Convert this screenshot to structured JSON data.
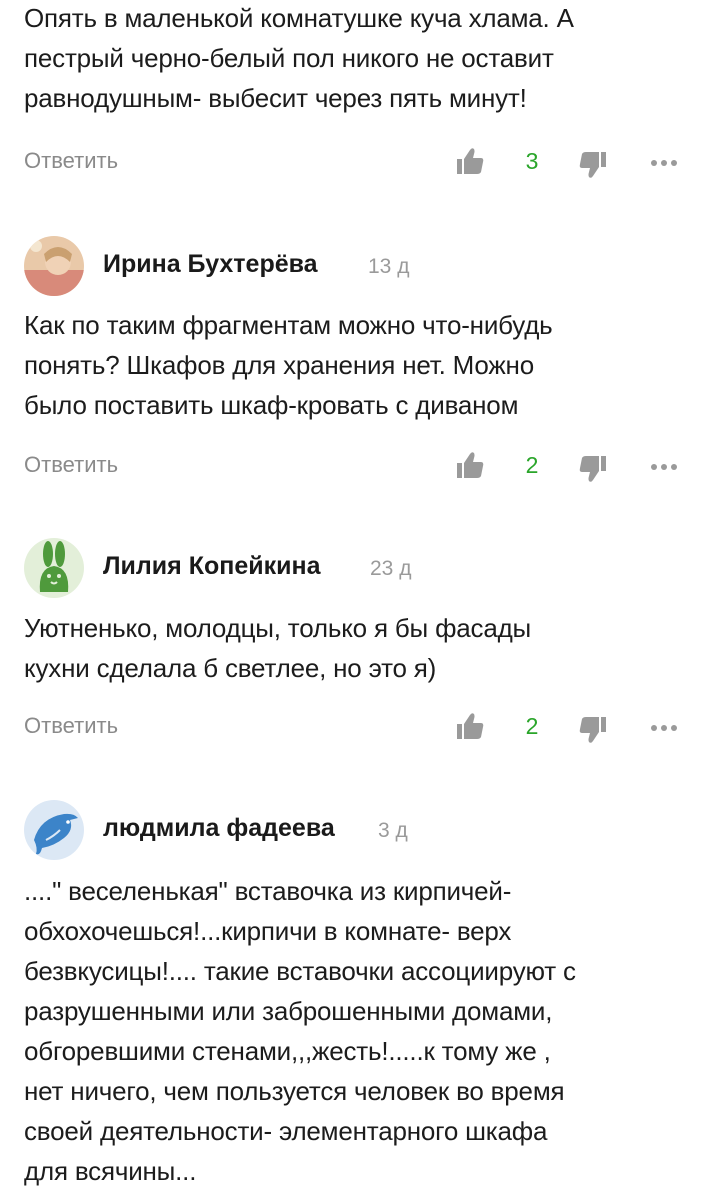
{
  "comments": [
    {
      "text_lines": [
        "Опять в маленькой комнатушке куча хлама. А",
        "пестрый черно-белый пол никого не оставит",
        "равнодушным- выбесит через пять минут!"
      ],
      "reply_label": "Ответить",
      "likes": "3"
    },
    {
      "author": "Ирина Бухтерёва",
      "date": "13 д",
      "text_lines": [
        "Как по таким фрагментам можно что-нибудь",
        "понять? Шкафов для хранения нет. Можно",
        "было поставить шкаф-кровать с диваном"
      ],
      "reply_label": "Ответить",
      "likes": "2"
    },
    {
      "author": "Лилия Копейкина",
      "date": "23 д",
      "text_lines": [
        "Уютненько, молодцы, только я бы фасады",
        "кухни сделала б светлее, но это я)"
      ],
      "reply_label": "Ответить",
      "likes": "2"
    },
    {
      "author": "людмила фадеева",
      "date": "3 д",
      "text_lines": [
        "....\" веселенькая\" вставочка из кирпичей-",
        "обхохочешься!...кирпичи в комнате- верх",
        "безвкусицы!.... такие вставочки ассоциируют с",
        "разрушенными или заброшенными домами,",
        "обгоревшими стенами,,,жесть!.....к тому же ,",
        "нет ничего, чем пользуется человек во время",
        "своей деятельности- элементарного шкафа",
        "для всячины..."
      ]
    }
  ],
  "icons": {
    "like": "thumbs-up-icon",
    "dislike": "thumbs-down-icon",
    "more": "more-dots-icon"
  },
  "colors": {
    "like_count": "#2aa52a",
    "secondary_text": "#8a8a8a",
    "icon_gray": "#999999"
  }
}
